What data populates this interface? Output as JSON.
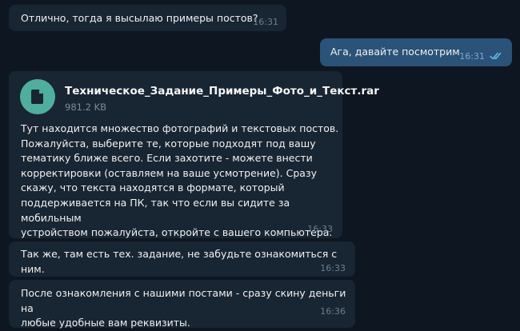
{
  "messages": [
    {
      "text": "Отлично, тогда я высылаю примеры постов?",
      "time": "16:31"
    },
    {
      "text": "Ага, давайте посмотрим",
      "time": "16:31"
    },
    {
      "file_name": "Техническое_Задание_Примеры_Фото_и_Текст.rar",
      "file_size": "981.2 KB",
      "text": "Тут находится множество фотографий и текстовых постов.\nПожалуйста, выберите те, которые подходят под вашу\nтематику ближе всего. Если захотите - можете внести\nкорректировки (оставляем на ваше усмотрение). Сразу\nскажу, что текста находятся в формате, который\nподдерживается на ПК, так что если вы сидите за мобильным\nустройством пожалуйста, откройте с вашего компьютера.",
      "time": "16:33"
    },
    {
      "text": "Так же, там есть тех. задание, не забудьте ознакомиться с ним.",
      "time": "16:33"
    },
    {
      "text": "После ознакомления с нашими постами - сразу скину деньги на\nлюбые удобные вам реквизиты.",
      "time": "16:36"
    }
  ],
  "colors": {
    "background": "#0e1621",
    "incoming_bubble": "#182533",
    "outgoing_bubble": "#2b5278",
    "file_icon": "#4fae9d",
    "read_ticks": "#5fc0ee"
  },
  "icons": [
    "document-icon",
    "double-check-icon"
  ]
}
